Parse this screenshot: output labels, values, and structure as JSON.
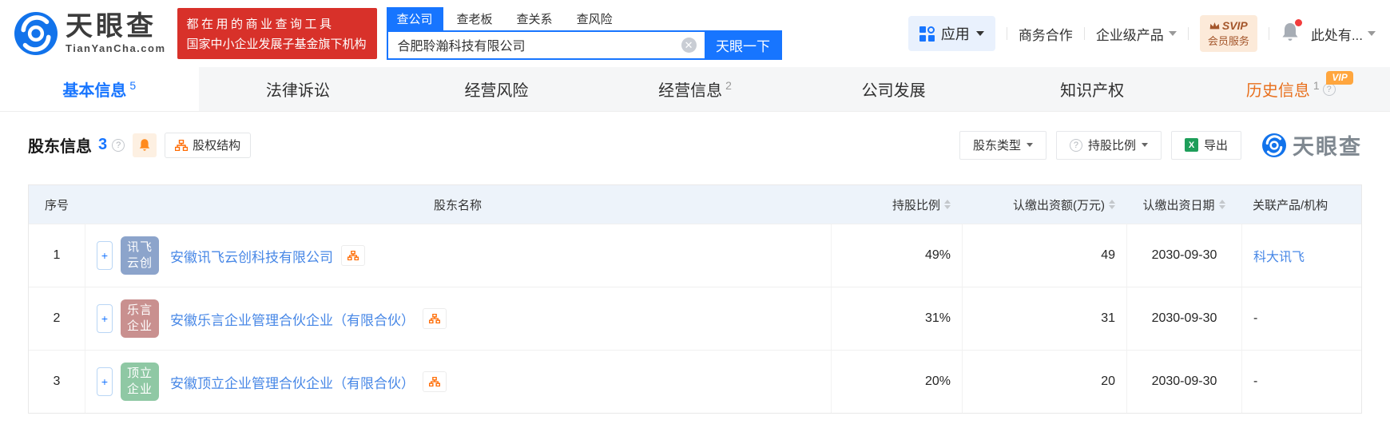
{
  "colors": {
    "brand_blue": "#1775ff",
    "link_blue": "#4787e6",
    "orange": "#ff6a00",
    "banner_red": "#d8312a",
    "history_orange": "#e8701e",
    "table_header_bg": "#edf3fa"
  },
  "header": {
    "logo": {
      "title": "天眼查",
      "subtitle": "TianYanCha.com"
    },
    "promo": {
      "line1": "都在用的商业查询工具",
      "line2": "国家中小企业发展子基金旗下机构"
    },
    "search": {
      "tabs": [
        {
          "label": "查公司"
        },
        {
          "label": "查老板"
        },
        {
          "label": "查关系"
        },
        {
          "label": "查风险"
        }
      ],
      "value": "合肥聆瀚科技有限公司",
      "button_label": "天眼一下"
    },
    "nav": {
      "apps_label": "应用",
      "cooperation_label": "商务合作",
      "enterprise_label": "企业级产品",
      "svip_line1": "SVIP",
      "svip_line2": "会员服务",
      "user_label": "此处有..."
    }
  },
  "tabs": [
    {
      "label": "基本信息",
      "count": "5"
    },
    {
      "label": "法律诉讼",
      "count": ""
    },
    {
      "label": "经营风险",
      "count": ""
    },
    {
      "label": "经营信息",
      "count": "2"
    },
    {
      "label": "公司发展",
      "count": ""
    },
    {
      "label": "知识产权",
      "count": ""
    },
    {
      "label": "历史信息",
      "count": "1",
      "vip_tag": "VIP"
    }
  ],
  "section": {
    "title": "股东信息",
    "count": "3",
    "structure_button": "股权结构",
    "filter_type": "股东类型",
    "filter_ratio": "持股比例",
    "export_label": "导出",
    "watermark": "天眼查"
  },
  "table": {
    "columns": [
      "序号",
      "股东名称",
      "持股比例",
      "认缴出资额(万元)",
      "认缴出资日期",
      "关联产品/机构"
    ],
    "rows": [
      {
        "no": "1",
        "avatar": {
          "line1": "讯飞",
          "line2": "云创",
          "color": "#8ca4cb"
        },
        "name": "安徽讯飞云创科技有限公司",
        "ratio": "49%",
        "amount": "49",
        "date": "2030-09-30",
        "related": "科大讯飞"
      },
      {
        "no": "2",
        "avatar": {
          "line1": "乐言",
          "line2": "企业",
          "color": "#c9908f"
        },
        "name": "安徽乐言企业管理合伙企业（有限合伙）",
        "ratio": "31%",
        "amount": "31",
        "date": "2030-09-30",
        "related": "-"
      },
      {
        "no": "3",
        "avatar": {
          "line1": "顶立",
          "line2": "企业",
          "color": "#8fc8a4"
        },
        "name": "安徽顶立企业管理合伙企业（有限合伙）",
        "ratio": "20%",
        "amount": "20",
        "date": "2030-09-30",
        "related": "-"
      }
    ]
  }
}
